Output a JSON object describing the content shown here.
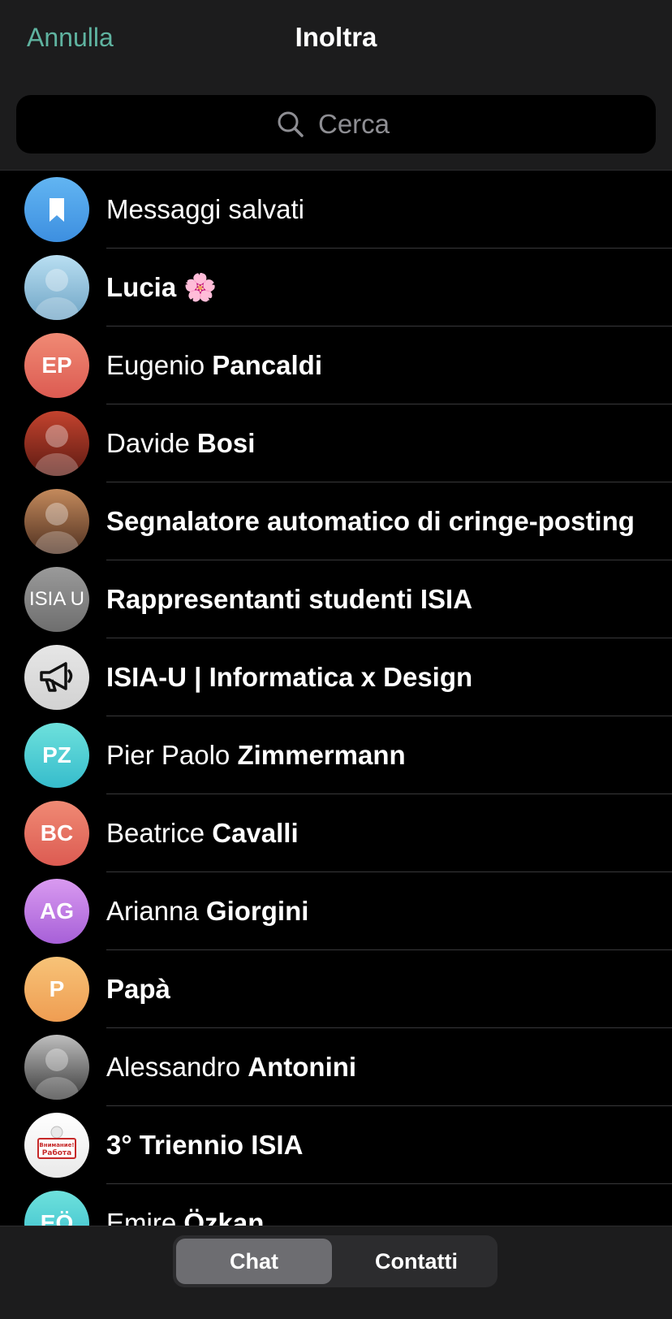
{
  "header": {
    "cancel_label": "Annulla",
    "title": "Inoltra"
  },
  "search": {
    "placeholder": "Cerca",
    "icon": "search-icon"
  },
  "chats": [
    {
      "first": "Messaggi salvati",
      "last": "",
      "initials": "",
      "avatar_type": "saved",
      "colors": [
        "#62b5f2",
        "#3d8fe0"
      ]
    },
    {
      "first": "Lucia 🌸",
      "last": "",
      "initials": "",
      "avatar_type": "photo",
      "colors": [
        "#b9dff2",
        "#6fa4c5"
      ]
    },
    {
      "first": "Eugenio",
      "last": "Pancaldi",
      "initials": "EP",
      "avatar_type": "initials",
      "colors": [
        "#f08a74",
        "#dc5b52"
      ]
    },
    {
      "first": "Davide",
      "last": "Bosi",
      "initials": "",
      "avatar_type": "photo",
      "colors": [
        "#c4432e",
        "#5c1a12"
      ]
    },
    {
      "first": "Segnalatore automatico di cringe-posting",
      "last": "",
      "initials": "",
      "avatar_type": "photo",
      "colors": [
        "#c48a5c",
        "#4f3020"
      ]
    },
    {
      "first": "Rappresentanti studenti ISIA",
      "last": "",
      "initials": "ISIA U",
      "avatar_type": "logo",
      "colors": [
        "#9a9a9a",
        "#6e6e6e"
      ]
    },
    {
      "first": "ISIA-U | Informatica x Design",
      "last": "",
      "initials": "",
      "avatar_type": "megaphone",
      "colors": [
        "#e6e6e6",
        "#d2d2d2"
      ]
    },
    {
      "first": "Pier Paolo",
      "last": "Zimmermann",
      "initials": "PZ",
      "avatar_type": "initials",
      "colors": [
        "#6ee1dc",
        "#36bccc"
      ]
    },
    {
      "first": "Beatrice",
      "last": "Cavalli",
      "initials": "BC",
      "avatar_type": "initials",
      "colors": [
        "#f08a74",
        "#dc5b52"
      ]
    },
    {
      "first": "Arianna",
      "last": "Giorgini",
      "initials": "AG",
      "avatar_type": "initials",
      "colors": [
        "#d99af0",
        "#a760d8"
      ]
    },
    {
      "first": "Papà",
      "last": "",
      "initials": "P",
      "avatar_type": "initials",
      "colors": [
        "#f7c378",
        "#ef9d52"
      ]
    },
    {
      "first": "Alessandro",
      "last": "Antonini",
      "initials": "",
      "avatar_type": "photo",
      "colors": [
        "#bfbfbf",
        "#3a3a3a"
      ]
    },
    {
      "first": "3° Triennio ISIA",
      "last": "",
      "initials": "",
      "avatar_type": "sticker",
      "colors": [
        "#ffffff",
        "#e9e9e9"
      ]
    },
    {
      "first": "Emire",
      "last": "Özkan",
      "initials": "EÖ",
      "avatar_type": "initials",
      "colors": [
        "#6ee1dc",
        "#36bccc"
      ]
    }
  ],
  "tabs": {
    "chat_label": "Chat",
    "contacts_label": "Contatti"
  },
  "accent": "#5fb3a0"
}
